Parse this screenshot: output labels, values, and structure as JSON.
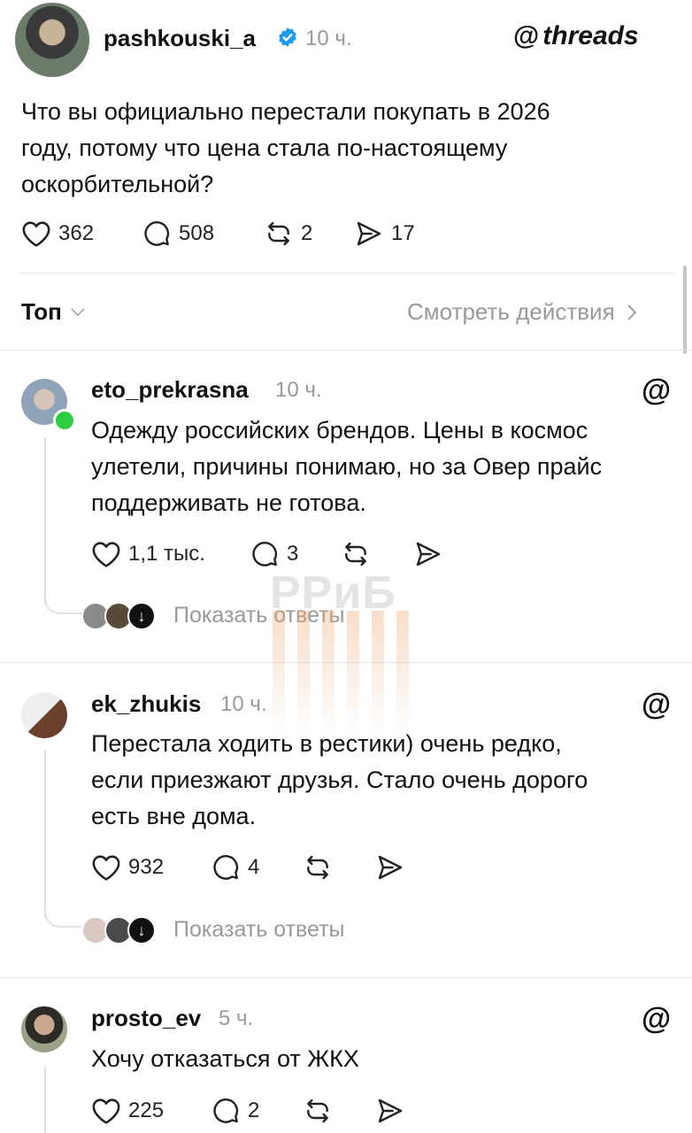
{
  "post": {
    "username": "pashkouski_a",
    "time": "10 ч.",
    "brand": "threads",
    "text_lines": [
      "Что вы официально перестали покупать в 2026",
      "году, потому что цена стала по-настоящему",
      "оскорбительной?"
    ],
    "likes": "362",
    "comments": "508",
    "reposts": "2",
    "shares": "17"
  },
  "sort": {
    "label": "Топ",
    "view_activity": "Смотреть действия"
  },
  "watermark": "РРиБ",
  "replies": [
    {
      "username": "eto_prekrasna",
      "time": "10 ч.",
      "text_lines": [
        "Одежду российских брендов. Цены в космос",
        "улетели, причины понимаю, но за Овер прайс",
        "поддерживать не готова."
      ],
      "likes": "1,1 тыс.",
      "comments": "3",
      "show_replies": "Показать ответы"
    },
    {
      "username": "ek_zhukis",
      "time": "10 ч.",
      "text_lines": [
        "Перестала ходить в рестики) очень редко,",
        "если приезжают друзья. Стало очень дорого",
        "есть вне дома."
      ],
      "likes": "932",
      "comments": "4",
      "show_replies": "Показать ответы"
    },
    {
      "username": "prosto_ev",
      "time": "5 ч.",
      "text_lines": [
        "Хочу отказаться от ЖКХ"
      ],
      "likes": "225",
      "comments": "2"
    }
  ],
  "colors": {
    "verified": "#1d9bf0",
    "online": "#2ecc40",
    "muted_text": "#999999"
  }
}
